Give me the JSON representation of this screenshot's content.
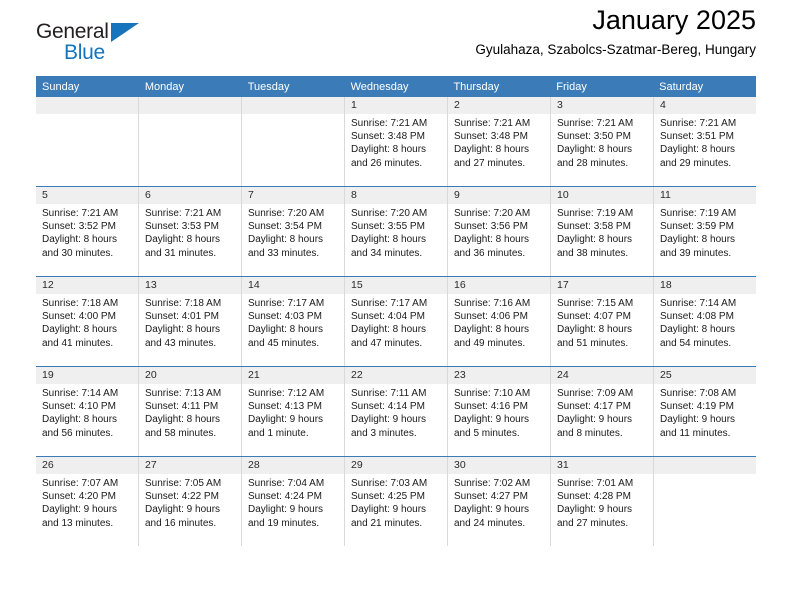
{
  "brand": {
    "name_part1": "General",
    "name_part2": "Blue",
    "triangle_icon": "triangle-icon",
    "colors": {
      "blue": "#1574bb",
      "dark": "#231f20"
    }
  },
  "header": {
    "title": "January 2025",
    "subtitle": "Gyulahaza, Szabolcs-Szatmar-Bereg, Hungary"
  },
  "theme": {
    "header_bar": "#3b7cb8",
    "day_band": "#efefef",
    "grid_line": "#d9d9d9"
  },
  "weekdays": [
    "Sunday",
    "Monday",
    "Tuesday",
    "Wednesday",
    "Thursday",
    "Friday",
    "Saturday"
  ],
  "labels": {
    "sunrise": "Sunrise:",
    "sunset": "Sunset:",
    "daylight": "Daylight:"
  },
  "weeks": [
    [
      {
        "day": "",
        "empty": true,
        "sunrise": "",
        "sunset": "",
        "daylight_line1": "",
        "daylight_line2": ""
      },
      {
        "day": "",
        "empty": true,
        "sunrise": "",
        "sunset": "",
        "daylight_line1": "",
        "daylight_line2": ""
      },
      {
        "day": "",
        "empty": true,
        "sunrise": "",
        "sunset": "",
        "daylight_line1": "",
        "daylight_line2": ""
      },
      {
        "day": "1",
        "empty": false,
        "sunrise": "Sunrise: 7:21 AM",
        "sunset": "Sunset: 3:48 PM",
        "daylight_line1": "Daylight: 8 hours",
        "daylight_line2": "and 26 minutes."
      },
      {
        "day": "2",
        "empty": false,
        "sunrise": "Sunrise: 7:21 AM",
        "sunset": "Sunset: 3:48 PM",
        "daylight_line1": "Daylight: 8 hours",
        "daylight_line2": "and 27 minutes."
      },
      {
        "day": "3",
        "empty": false,
        "sunrise": "Sunrise: 7:21 AM",
        "sunset": "Sunset: 3:50 PM",
        "daylight_line1": "Daylight: 8 hours",
        "daylight_line2": "and 28 minutes."
      },
      {
        "day": "4",
        "empty": false,
        "sunrise": "Sunrise: 7:21 AM",
        "sunset": "Sunset: 3:51 PM",
        "daylight_line1": "Daylight: 8 hours",
        "daylight_line2": "and 29 minutes."
      }
    ],
    [
      {
        "day": "5",
        "empty": false,
        "sunrise": "Sunrise: 7:21 AM",
        "sunset": "Sunset: 3:52 PM",
        "daylight_line1": "Daylight: 8 hours",
        "daylight_line2": "and 30 minutes."
      },
      {
        "day": "6",
        "empty": false,
        "sunrise": "Sunrise: 7:21 AM",
        "sunset": "Sunset: 3:53 PM",
        "daylight_line1": "Daylight: 8 hours",
        "daylight_line2": "and 31 minutes."
      },
      {
        "day": "7",
        "empty": false,
        "sunrise": "Sunrise: 7:20 AM",
        "sunset": "Sunset: 3:54 PM",
        "daylight_line1": "Daylight: 8 hours",
        "daylight_line2": "and 33 minutes."
      },
      {
        "day": "8",
        "empty": false,
        "sunrise": "Sunrise: 7:20 AM",
        "sunset": "Sunset: 3:55 PM",
        "daylight_line1": "Daylight: 8 hours",
        "daylight_line2": "and 34 minutes."
      },
      {
        "day": "9",
        "empty": false,
        "sunrise": "Sunrise: 7:20 AM",
        "sunset": "Sunset: 3:56 PM",
        "daylight_line1": "Daylight: 8 hours",
        "daylight_line2": "and 36 minutes."
      },
      {
        "day": "10",
        "empty": false,
        "sunrise": "Sunrise: 7:19 AM",
        "sunset": "Sunset: 3:58 PM",
        "daylight_line1": "Daylight: 8 hours",
        "daylight_line2": "and 38 minutes."
      },
      {
        "day": "11",
        "empty": false,
        "sunrise": "Sunrise: 7:19 AM",
        "sunset": "Sunset: 3:59 PM",
        "daylight_line1": "Daylight: 8 hours",
        "daylight_line2": "and 39 minutes."
      }
    ],
    [
      {
        "day": "12",
        "empty": false,
        "sunrise": "Sunrise: 7:18 AM",
        "sunset": "Sunset: 4:00 PM",
        "daylight_line1": "Daylight: 8 hours",
        "daylight_line2": "and 41 minutes."
      },
      {
        "day": "13",
        "empty": false,
        "sunrise": "Sunrise: 7:18 AM",
        "sunset": "Sunset: 4:01 PM",
        "daylight_line1": "Daylight: 8 hours",
        "daylight_line2": "and 43 minutes."
      },
      {
        "day": "14",
        "empty": false,
        "sunrise": "Sunrise: 7:17 AM",
        "sunset": "Sunset: 4:03 PM",
        "daylight_line1": "Daylight: 8 hours",
        "daylight_line2": "and 45 minutes."
      },
      {
        "day": "15",
        "empty": false,
        "sunrise": "Sunrise: 7:17 AM",
        "sunset": "Sunset: 4:04 PM",
        "daylight_line1": "Daylight: 8 hours",
        "daylight_line2": "and 47 minutes."
      },
      {
        "day": "16",
        "empty": false,
        "sunrise": "Sunrise: 7:16 AM",
        "sunset": "Sunset: 4:06 PM",
        "daylight_line1": "Daylight: 8 hours",
        "daylight_line2": "and 49 minutes."
      },
      {
        "day": "17",
        "empty": false,
        "sunrise": "Sunrise: 7:15 AM",
        "sunset": "Sunset: 4:07 PM",
        "daylight_line1": "Daylight: 8 hours",
        "daylight_line2": "and 51 minutes."
      },
      {
        "day": "18",
        "empty": false,
        "sunrise": "Sunrise: 7:14 AM",
        "sunset": "Sunset: 4:08 PM",
        "daylight_line1": "Daylight: 8 hours",
        "daylight_line2": "and 54 minutes."
      }
    ],
    [
      {
        "day": "19",
        "empty": false,
        "sunrise": "Sunrise: 7:14 AM",
        "sunset": "Sunset: 4:10 PM",
        "daylight_line1": "Daylight: 8 hours",
        "daylight_line2": "and 56 minutes."
      },
      {
        "day": "20",
        "empty": false,
        "sunrise": "Sunrise: 7:13 AM",
        "sunset": "Sunset: 4:11 PM",
        "daylight_line1": "Daylight: 8 hours",
        "daylight_line2": "and 58 minutes."
      },
      {
        "day": "21",
        "empty": false,
        "sunrise": "Sunrise: 7:12 AM",
        "sunset": "Sunset: 4:13 PM",
        "daylight_line1": "Daylight: 9 hours",
        "daylight_line2": "and 1 minute."
      },
      {
        "day": "22",
        "empty": false,
        "sunrise": "Sunrise: 7:11 AM",
        "sunset": "Sunset: 4:14 PM",
        "daylight_line1": "Daylight: 9 hours",
        "daylight_line2": "and 3 minutes."
      },
      {
        "day": "23",
        "empty": false,
        "sunrise": "Sunrise: 7:10 AM",
        "sunset": "Sunset: 4:16 PM",
        "daylight_line1": "Daylight: 9 hours",
        "daylight_line2": "and 5 minutes."
      },
      {
        "day": "24",
        "empty": false,
        "sunrise": "Sunrise: 7:09 AM",
        "sunset": "Sunset: 4:17 PM",
        "daylight_line1": "Daylight: 9 hours",
        "daylight_line2": "and 8 minutes."
      },
      {
        "day": "25",
        "empty": false,
        "sunrise": "Sunrise: 7:08 AM",
        "sunset": "Sunset: 4:19 PM",
        "daylight_line1": "Daylight: 9 hours",
        "daylight_line2": "and 11 minutes."
      }
    ],
    [
      {
        "day": "26",
        "empty": false,
        "sunrise": "Sunrise: 7:07 AM",
        "sunset": "Sunset: 4:20 PM",
        "daylight_line1": "Daylight: 9 hours",
        "daylight_line2": "and 13 minutes."
      },
      {
        "day": "27",
        "empty": false,
        "sunrise": "Sunrise: 7:05 AM",
        "sunset": "Sunset: 4:22 PM",
        "daylight_line1": "Daylight: 9 hours",
        "daylight_line2": "and 16 minutes."
      },
      {
        "day": "28",
        "empty": false,
        "sunrise": "Sunrise: 7:04 AM",
        "sunset": "Sunset: 4:24 PM",
        "daylight_line1": "Daylight: 9 hours",
        "daylight_line2": "and 19 minutes."
      },
      {
        "day": "29",
        "empty": false,
        "sunrise": "Sunrise: 7:03 AM",
        "sunset": "Sunset: 4:25 PM",
        "daylight_line1": "Daylight: 9 hours",
        "daylight_line2": "and 21 minutes."
      },
      {
        "day": "30",
        "empty": false,
        "sunrise": "Sunrise: 7:02 AM",
        "sunset": "Sunset: 4:27 PM",
        "daylight_line1": "Daylight: 9 hours",
        "daylight_line2": "and 24 minutes."
      },
      {
        "day": "31",
        "empty": false,
        "sunrise": "Sunrise: 7:01 AM",
        "sunset": "Sunset: 4:28 PM",
        "daylight_line1": "Daylight: 9 hours",
        "daylight_line2": "and 27 minutes."
      },
      {
        "day": "",
        "empty": true,
        "sunrise": "",
        "sunset": "",
        "daylight_line1": "",
        "daylight_line2": ""
      }
    ]
  ]
}
